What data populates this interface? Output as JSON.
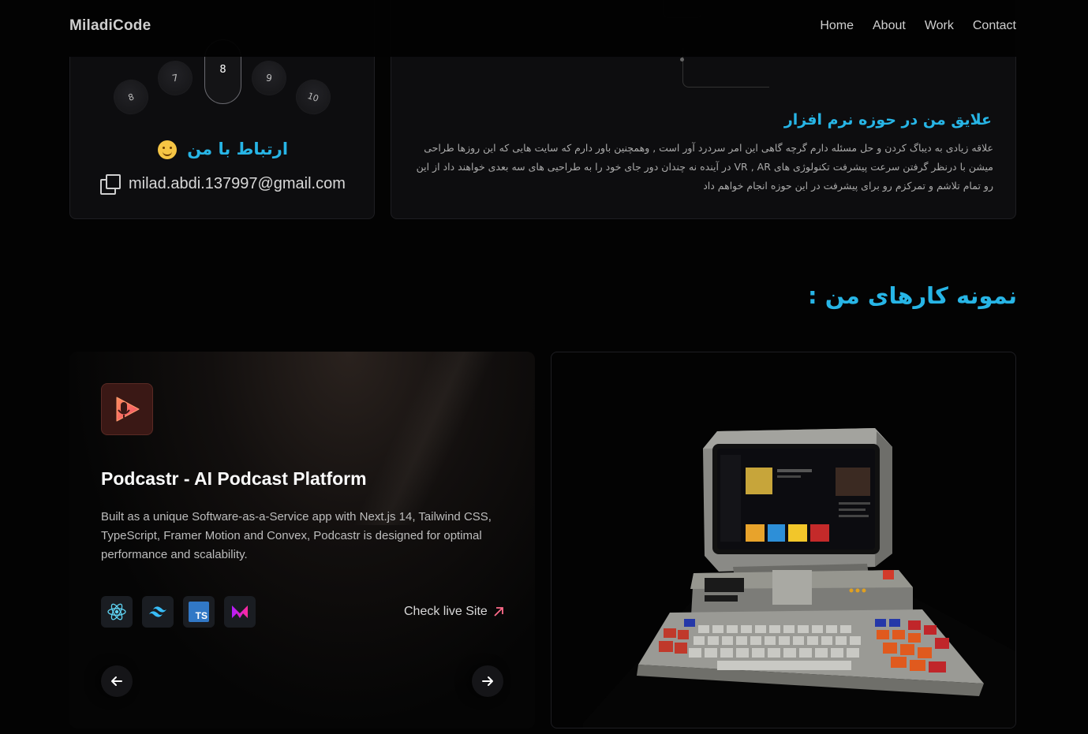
{
  "nav": {
    "brand": "MiladiCode",
    "links": [
      "Home",
      "About",
      "Work",
      "Contact"
    ]
  },
  "contact": {
    "dials": [
      "8",
      "7",
      "8",
      "9",
      "10"
    ],
    "title": "ارتباط با من",
    "email": "milad.abdi.137997@gmail.com"
  },
  "interests": {
    "title": "علایق من در حوزه نرم افزار",
    "text": "علاقه زیادی به دیباگ کردن و حل مسئله دارم گرچه گاهی این امر سردرد آور است , وهمچنین باور دارم که سایت هایی که این روزها طراحی میشن با درنظر گرفتن سرعت پیشرفت تکنولوژی های VR , AR در آینده نه چندان دور جای خود را به طراحیی های سه بعدی خواهند داد از این رو تمام تلاشم و تمرکزم رو برای پیشرفت در این حوزه انجام خواهم داد"
  },
  "works": {
    "title": "نمونه کارهای من :"
  },
  "project": {
    "title": "Podcastr - AI Podcast Platform",
    "description": "Built as a unique Software-as-a-Service app with Next.js 14, Tailwind CSS, TypeScript, Framer Motion and Convex, Podcastr is designed for optimal performance and scalability.",
    "tech_icons": [
      "react-icon",
      "tailwind-icon",
      "typescript-icon",
      "framer-motion-icon"
    ],
    "ts_label": "TS",
    "live_label": "Check live Site",
    "accent": "#27b5e6"
  }
}
